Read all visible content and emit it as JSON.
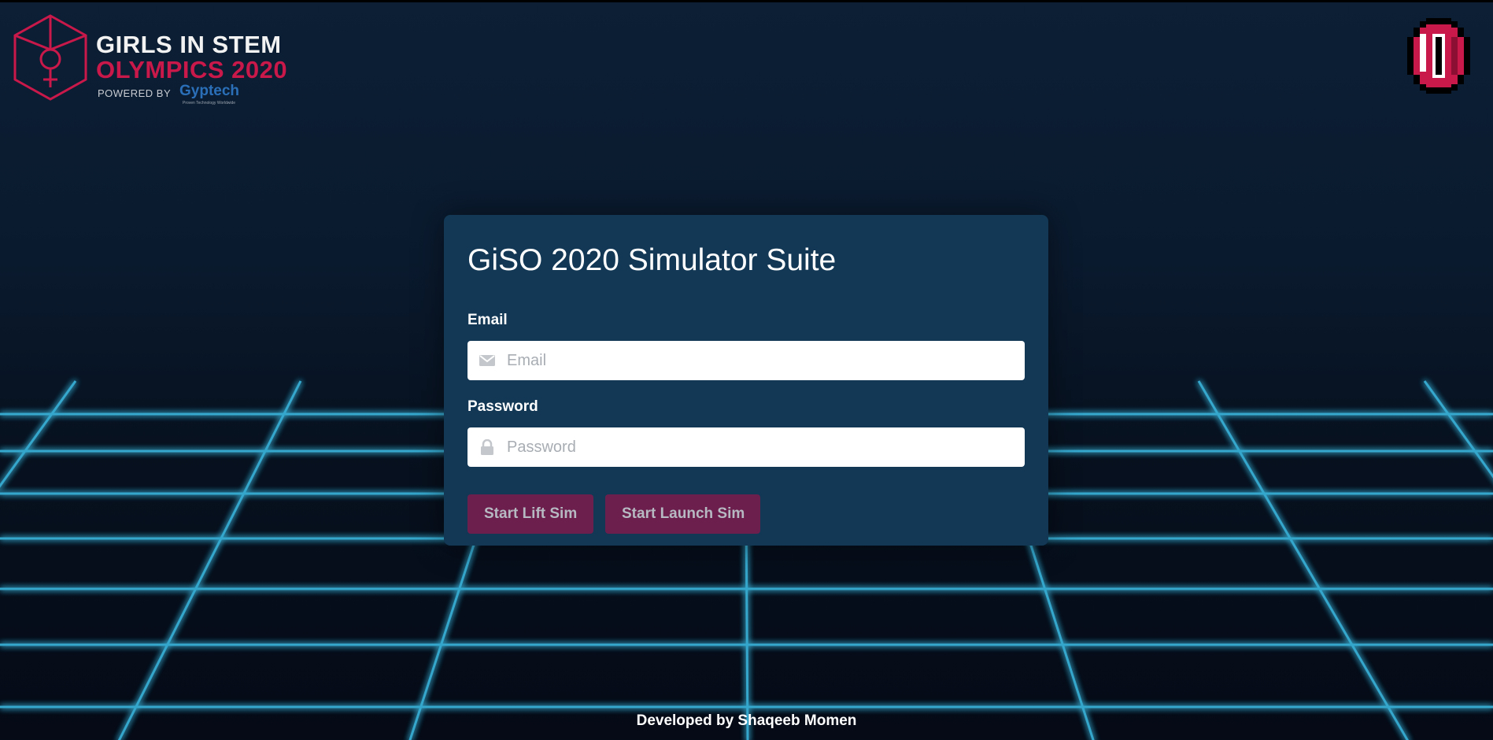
{
  "logo": {
    "line1": "GIRLS IN STEM",
    "line2": "OLYMPICS 2020",
    "powered_by": "POWERED BY",
    "sponsor": "Gyptech",
    "sponsor_tagline": "Proven Technology Worldwide",
    "icon": "venus-cube-icon"
  },
  "coin": {
    "icon": "pixel-coin-icon"
  },
  "login": {
    "title": "GiSO 2020 Simulator Suite",
    "email_label": "Email",
    "email_placeholder": "Email",
    "email_icon": "envelope-icon",
    "password_label": "Password",
    "password_placeholder": "Password",
    "password_icon": "lock-icon",
    "start_lift_label": "Start Lift Sim",
    "start_launch_label": "Start Launch Sim"
  },
  "footer": {
    "credit": "Developed by Shaqeeb Momen"
  },
  "colors": {
    "background_top": "#0c1f35",
    "background_bottom": "#050a16",
    "grid_neon": "#3ab8e0",
    "card": "#123855",
    "button": "#6c1f4d",
    "brand_red": "#c9184a",
    "sponsor_blue": "#2a6fb8"
  }
}
